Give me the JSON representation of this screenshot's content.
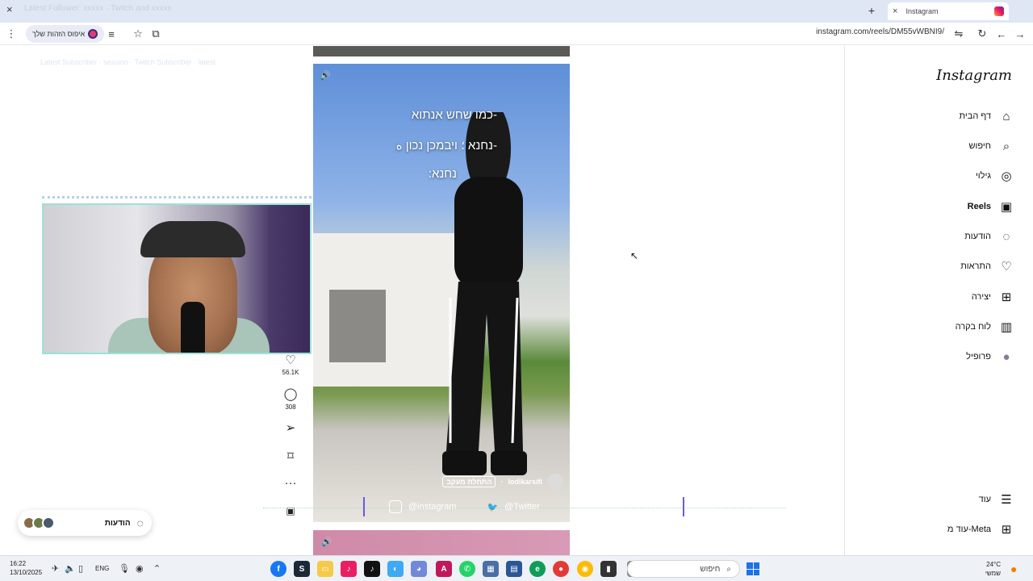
{
  "browser": {
    "tab_title": "Instagram",
    "tab_close": "×",
    "new_tab": "+",
    "window_close": "×",
    "url": "instagram.com/reels/DM55vWBNI9/",
    "identity_pill": "איפוס הזהות שלך",
    "overlay_faded_text": "Latest Follower: xxxxx · Twitch and xxxxx"
  },
  "instagram": {
    "logo": "Instagram",
    "nav": [
      {
        "label": "דף הבית",
        "icon": "home-icon",
        "glyph": "⌂"
      },
      {
        "label": "חיפוש",
        "icon": "search-icon",
        "glyph": "⌕"
      },
      {
        "label": "גילוי",
        "icon": "explore-icon",
        "glyph": "◎"
      },
      {
        "label": "Reels",
        "icon": "reels-icon",
        "glyph": "▣"
      },
      {
        "label": "הודעות",
        "icon": "messenger-icon",
        "glyph": "◌"
      },
      {
        "label": "התראות",
        "icon": "heart-icon",
        "glyph": "♡"
      },
      {
        "label": "יצירה",
        "icon": "create-icon",
        "glyph": "⊞"
      },
      {
        "label": "לוח בקרה",
        "icon": "dashboard-icon",
        "glyph": "▥"
      },
      {
        "label": "פרופיל",
        "icon": "profile-avatar-icon",
        "glyph": "●"
      }
    ],
    "more": {
      "label": "עוד",
      "glyph": "☰"
    },
    "meta": {
      "label": "עוד מ-Meta",
      "glyph": "⊞"
    }
  },
  "reel": {
    "subtitle_lines": [
      "-כמו שחש אנתוא",
      "-נחנא ؛ ויבמכן נכון ه",
      "נחנא:"
    ],
    "username": "lodikarsifi",
    "follow_label": "התחלת מעקב",
    "like_count": "56.1K",
    "comment_count": "308"
  },
  "social_bar": {
    "instagram_handle": "@instagram",
    "twitter_handle": "@Twitter"
  },
  "messages_pill": {
    "label": "הודעות"
  },
  "taskbar": {
    "time": "16:22",
    "date": "13/10/2025",
    "lang": "ENG",
    "search_placeholder": "חיפוש",
    "weather_temp": "24°C",
    "weather_desc": "שמשי"
  },
  "colors": {
    "accent": "#0095f6",
    "instagram_gradient_start": "#f9a825",
    "instagram_gradient_end": "#7b1fa2"
  }
}
